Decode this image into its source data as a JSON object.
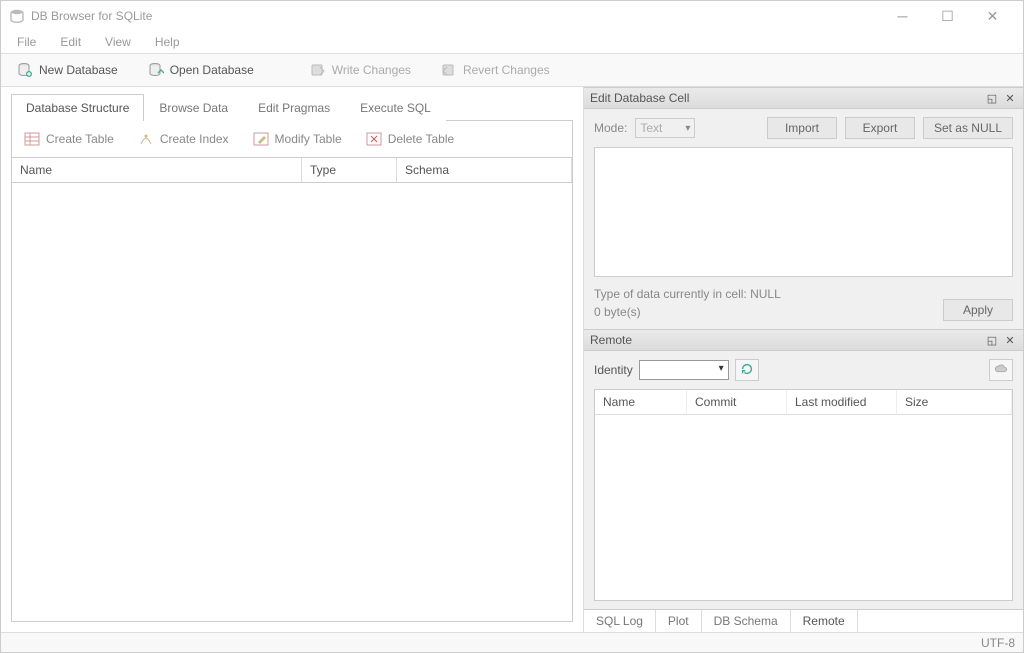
{
  "window": {
    "title": "DB Browser for SQLite"
  },
  "menubar": {
    "items": [
      "File",
      "Edit",
      "View",
      "Help"
    ]
  },
  "toolbar": {
    "new_db": "New Database",
    "open_db": "Open Database",
    "write_changes": "Write Changes",
    "revert_changes": "Revert Changes"
  },
  "main_tabs": {
    "structure": "Database Structure",
    "browse": "Browse Data",
    "pragmas": "Edit Pragmas",
    "execute": "Execute SQL"
  },
  "structure_toolbar": {
    "create_table": "Create Table",
    "create_index": "Create Index",
    "modify_table": "Modify Table",
    "delete_table": "Delete Table"
  },
  "structure_columns": {
    "name": "Name",
    "type": "Type",
    "schema": "Schema"
  },
  "edit_cell": {
    "title": "Edit Database Cell",
    "mode_label": "Mode:",
    "mode_value": "Text",
    "import": "Import",
    "export": "Export",
    "set_null": "Set as NULL",
    "info_line1": "Type of data currently in cell: NULL",
    "info_line2": "0 byte(s)",
    "apply": "Apply"
  },
  "remote": {
    "title": "Remote",
    "identity_label": "Identity",
    "columns": {
      "name": "Name",
      "commit": "Commit",
      "last_modified": "Last modified",
      "size": "Size"
    }
  },
  "bottom_tabs": {
    "sql_log": "SQL Log",
    "plot": "Plot",
    "db_schema": "DB Schema",
    "remote": "Remote"
  },
  "statusbar": {
    "encoding": "UTF-8"
  }
}
